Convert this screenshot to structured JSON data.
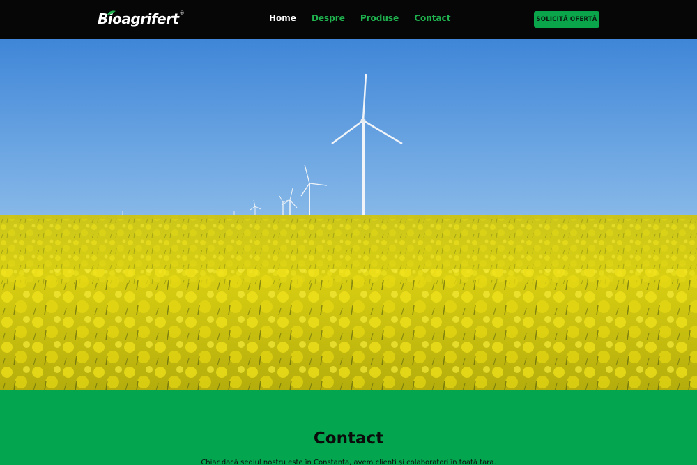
{
  "header": {
    "logo_text": "Bioagrifert",
    "logo_reg": "®",
    "nav": [
      {
        "label": "Home",
        "active": true
      },
      {
        "label": "Despre",
        "active": false
      },
      {
        "label": "Produse",
        "active": false
      },
      {
        "label": "Contact",
        "active": false
      }
    ],
    "cta_label": "SOLICITĂ OFERTĂ"
  },
  "hero": {
    "image": "rapeseed-field-wind-turbines",
    "sky_color": "#4b8fd8",
    "field_color": "#d4cc14"
  },
  "contact": {
    "title": "Contact",
    "text": "Chiar dacă sediul nostru este în Constanța, avem clienți și colaboratori în toată țara."
  },
  "colors": {
    "header_bg": "#060606",
    "accent": "#0aa54a",
    "nav_inactive": "#1fb24f",
    "section_bg": "#03a64f"
  }
}
